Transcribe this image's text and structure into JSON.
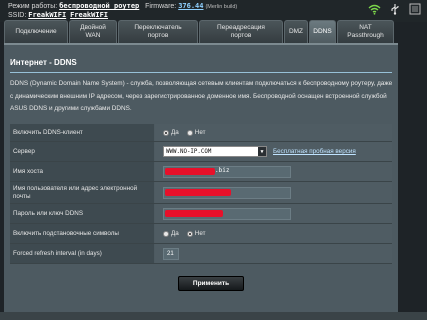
{
  "header": {
    "mode_label": "Режим работы:",
    "mode_value": "беспроводной роутер",
    "firmware_label": "Firmware:",
    "firmware_value": "376.44",
    "firmware_note": "(Merlin build)",
    "ssid_label": "SSID:",
    "ssid_1": "FreakWIFI",
    "ssid_2": "FreakWIFI"
  },
  "tabs": [
    {
      "label": "Подключение",
      "active": false
    },
    {
      "label": "Двойной\nWAN",
      "active": false
    },
    {
      "label": "Переключатель\nпортов",
      "active": false
    },
    {
      "label": "Переадресация\nпортов",
      "active": false
    },
    {
      "label": "DMZ",
      "active": false
    },
    {
      "label": "DDNS",
      "active": true
    },
    {
      "label": "NAT\nPassthrough",
      "active": false
    }
  ],
  "panel": {
    "title": "Интернет - DDNS",
    "description": "DDNS (Dynamic Domain Name System) - служба, позволяющая сетевым клиентам подключаться к беспроводному роутеру, даже с динамическим внешним IP адресом, через зарегистрированное доменное имя. Беспроводной оснащен встроенной службой ASUS DDNS и другими службами DDNS."
  },
  "form": {
    "enable_label": "Включить DDNS-клиент",
    "yes": "Да",
    "no": "Нет",
    "server_label": "Сервер",
    "server_value": "WWW.NO-IP.COM",
    "trial_link": "Бесплатная пробная версия",
    "host_label": "Имя хоста",
    "host_suffix": ".biz",
    "user_label": "Имя пользователя или адрес электронной почты",
    "password_label": "Пароль или ключ DDNS",
    "wildcard_label": "Включить подстановочные символы",
    "refresh_label": "Forced refresh interval (in days)",
    "refresh_value": "21",
    "apply": "Применить"
  },
  "colors": {
    "accent": "#97c1d8",
    "redaction": "#e8102a",
    "panel": "#4d5a61"
  },
  "icons": [
    "wifi-icon",
    "usb-icon",
    "settings-icon"
  ]
}
